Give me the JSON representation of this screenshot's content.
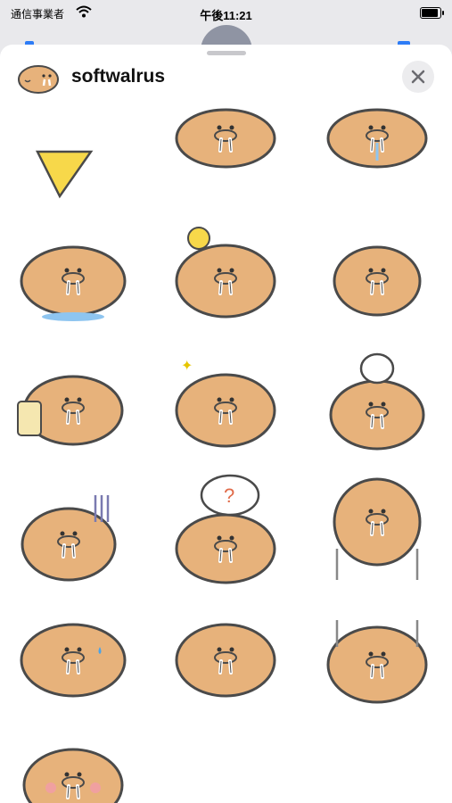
{
  "status_bar": {
    "carrier": "通信事業者",
    "time": "午後11:21",
    "battery_level": 1.0
  },
  "header": {
    "title": "softwalrus",
    "close_icon": "close-icon"
  },
  "stickers": [
    {
      "name": "sticker-cheese"
    },
    {
      "name": "sticker-walrus-peek"
    },
    {
      "name": "sticker-walrus-drool"
    },
    {
      "name": "sticker-drool-puddle"
    },
    {
      "name": "sticker-sunny-thinking"
    },
    {
      "name": "sticker-trembling"
    },
    {
      "name": "sticker-drinking"
    },
    {
      "name": "sticker-sparkle-eyes"
    },
    {
      "name": "sticker-rice-ball"
    },
    {
      "name": "sticker-gloomy"
    },
    {
      "name": "sticker-question"
    },
    {
      "name": "sticker-shivering"
    },
    {
      "name": "sticker-sweating"
    },
    {
      "name": "sticker-plain"
    },
    {
      "name": "sticker-shocked"
    },
    {
      "name": "sticker-blushing"
    }
  ],
  "colors": {
    "body": "#e7b27b",
    "outline": "#4a4a4a",
    "accent_blue": "#2d7cf6"
  }
}
